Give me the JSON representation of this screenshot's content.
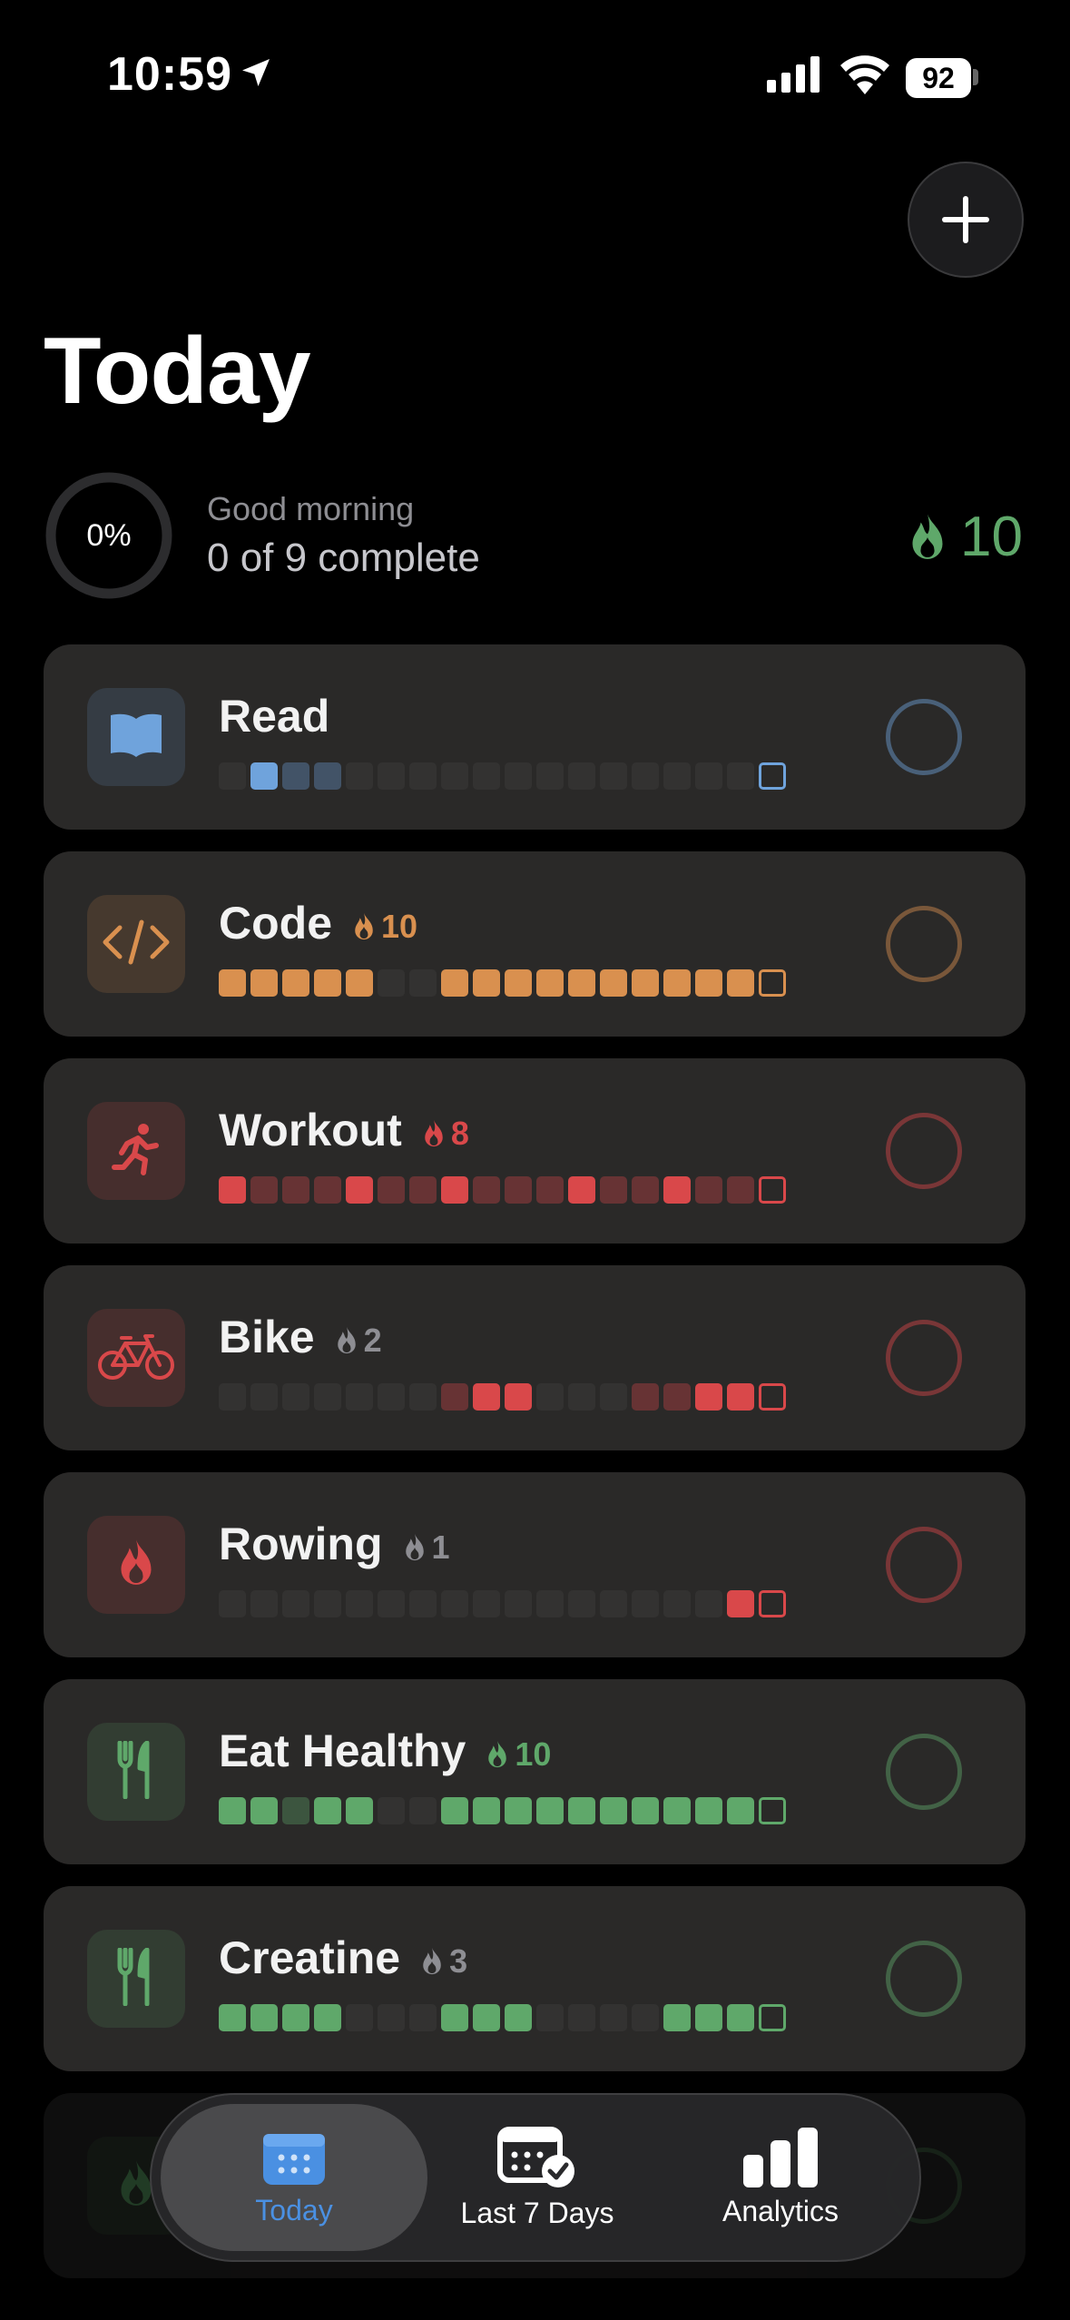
{
  "status_bar": {
    "time": "10:59",
    "battery": "92"
  },
  "header": {
    "title": "Today",
    "add_label": "+"
  },
  "summary": {
    "percent": "0%",
    "greeting": "Good morning",
    "complete_text": "0 of 9 complete",
    "overall_streak": "10",
    "streak_color": "#5fa86a"
  },
  "habits": [
    {
      "name": "Read",
      "streak": "",
      "color": "#6fa3dc",
      "icon": "book-icon",
      "days": [
        0,
        1,
        2,
        2,
        0,
        0,
        0,
        0,
        0,
        0,
        0,
        0,
        0,
        0,
        0,
        0,
        0,
        3
      ]
    },
    {
      "name": "Code",
      "streak": "10",
      "color": "#d9904f",
      "icon": "code-icon",
      "days": [
        1,
        1,
        1,
        1,
        1,
        0,
        0,
        1,
        1,
        1,
        1,
        1,
        1,
        1,
        1,
        1,
        1,
        3
      ]
    },
    {
      "name": "Workout",
      "streak": "8",
      "color": "#d9484a",
      "icon": "runner-icon",
      "days": [
        1,
        2,
        2,
        2,
        1,
        2,
        2,
        1,
        2,
        2,
        2,
        1,
        2,
        2,
        1,
        2,
        2,
        3
      ]
    },
    {
      "name": "Bike",
      "streak": "2",
      "color": "#d9484a",
      "icon": "bicycle-icon",
      "days": [
        0,
        0,
        0,
        0,
        0,
        0,
        0,
        2,
        1,
        1,
        0,
        0,
        0,
        2,
        2,
        1,
        1,
        3
      ]
    },
    {
      "name": "Rowing",
      "streak": "1",
      "color": "#d9484a",
      "icon": "flame-icon",
      "days": [
        0,
        0,
        0,
        0,
        0,
        0,
        0,
        0,
        0,
        0,
        0,
        0,
        0,
        0,
        0,
        0,
        1,
        3
      ]
    },
    {
      "name": "Eat Healthy",
      "streak": "10",
      "color": "#5fa86a",
      "icon": "fork-knife-icon",
      "days": [
        1,
        1,
        2,
        1,
        1,
        0,
        0,
        1,
        1,
        1,
        1,
        1,
        1,
        1,
        1,
        1,
        1,
        3
      ]
    },
    {
      "name": "Creatine",
      "streak": "3",
      "color": "#5fa86a",
      "icon": "fork-knife-icon",
      "days": [
        1,
        1,
        1,
        1,
        0,
        0,
        0,
        1,
        1,
        1,
        0,
        0,
        0,
        0,
        1,
        1,
        1,
        3
      ]
    }
  ],
  "tabs": [
    {
      "label": "Today",
      "icon": "calendar-icon",
      "active": true
    },
    {
      "label": "Last 7 Days",
      "icon": "calendar-check-icon",
      "active": false
    },
    {
      "label": "Analytics",
      "icon": "bar-chart-icon",
      "active": false
    }
  ]
}
